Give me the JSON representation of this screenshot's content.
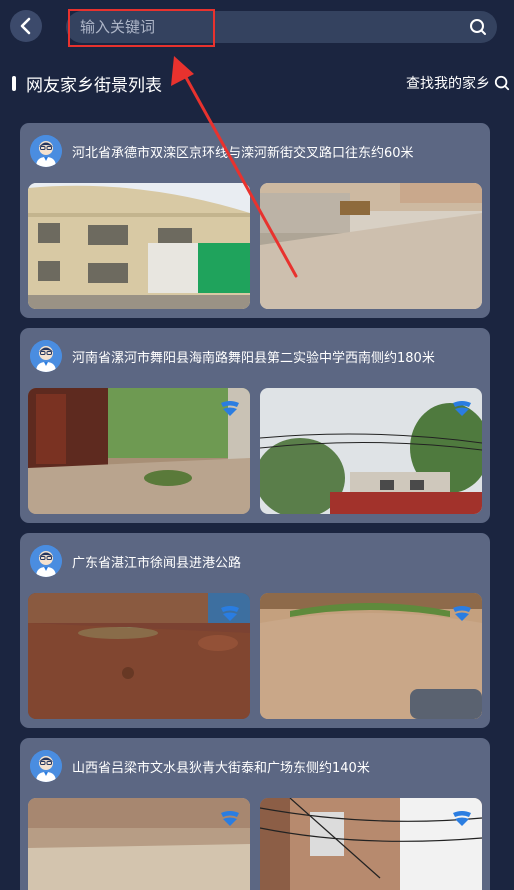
{
  "header": {
    "search_placeholder": "输入关键词"
  },
  "section": {
    "title": "网友家乡街景列表",
    "find_label": "查找我的家乡"
  },
  "cards": [
    {
      "address": "河北省承德市双滦区京环线与滦河新街交叉路口往东约60米"
    },
    {
      "address": "河南省漯河市舞阳县海南路舞阳县第二实验中学西南侧约180米"
    },
    {
      "address": "广东省湛江市徐闻县进港公路"
    },
    {
      "address": "山西省吕梁市文水县狄青大街泰和广场东侧约140米"
    }
  ],
  "colors": {
    "background": "#1b2540",
    "card": "#5c6783",
    "search_box": "#34425f",
    "accent_blue": "#2a7de1",
    "annotation_red": "#e8322e"
  },
  "icons": [
    "back-arrow-icon",
    "search-icon",
    "user-avatar-icon",
    "panorama-icon"
  ]
}
